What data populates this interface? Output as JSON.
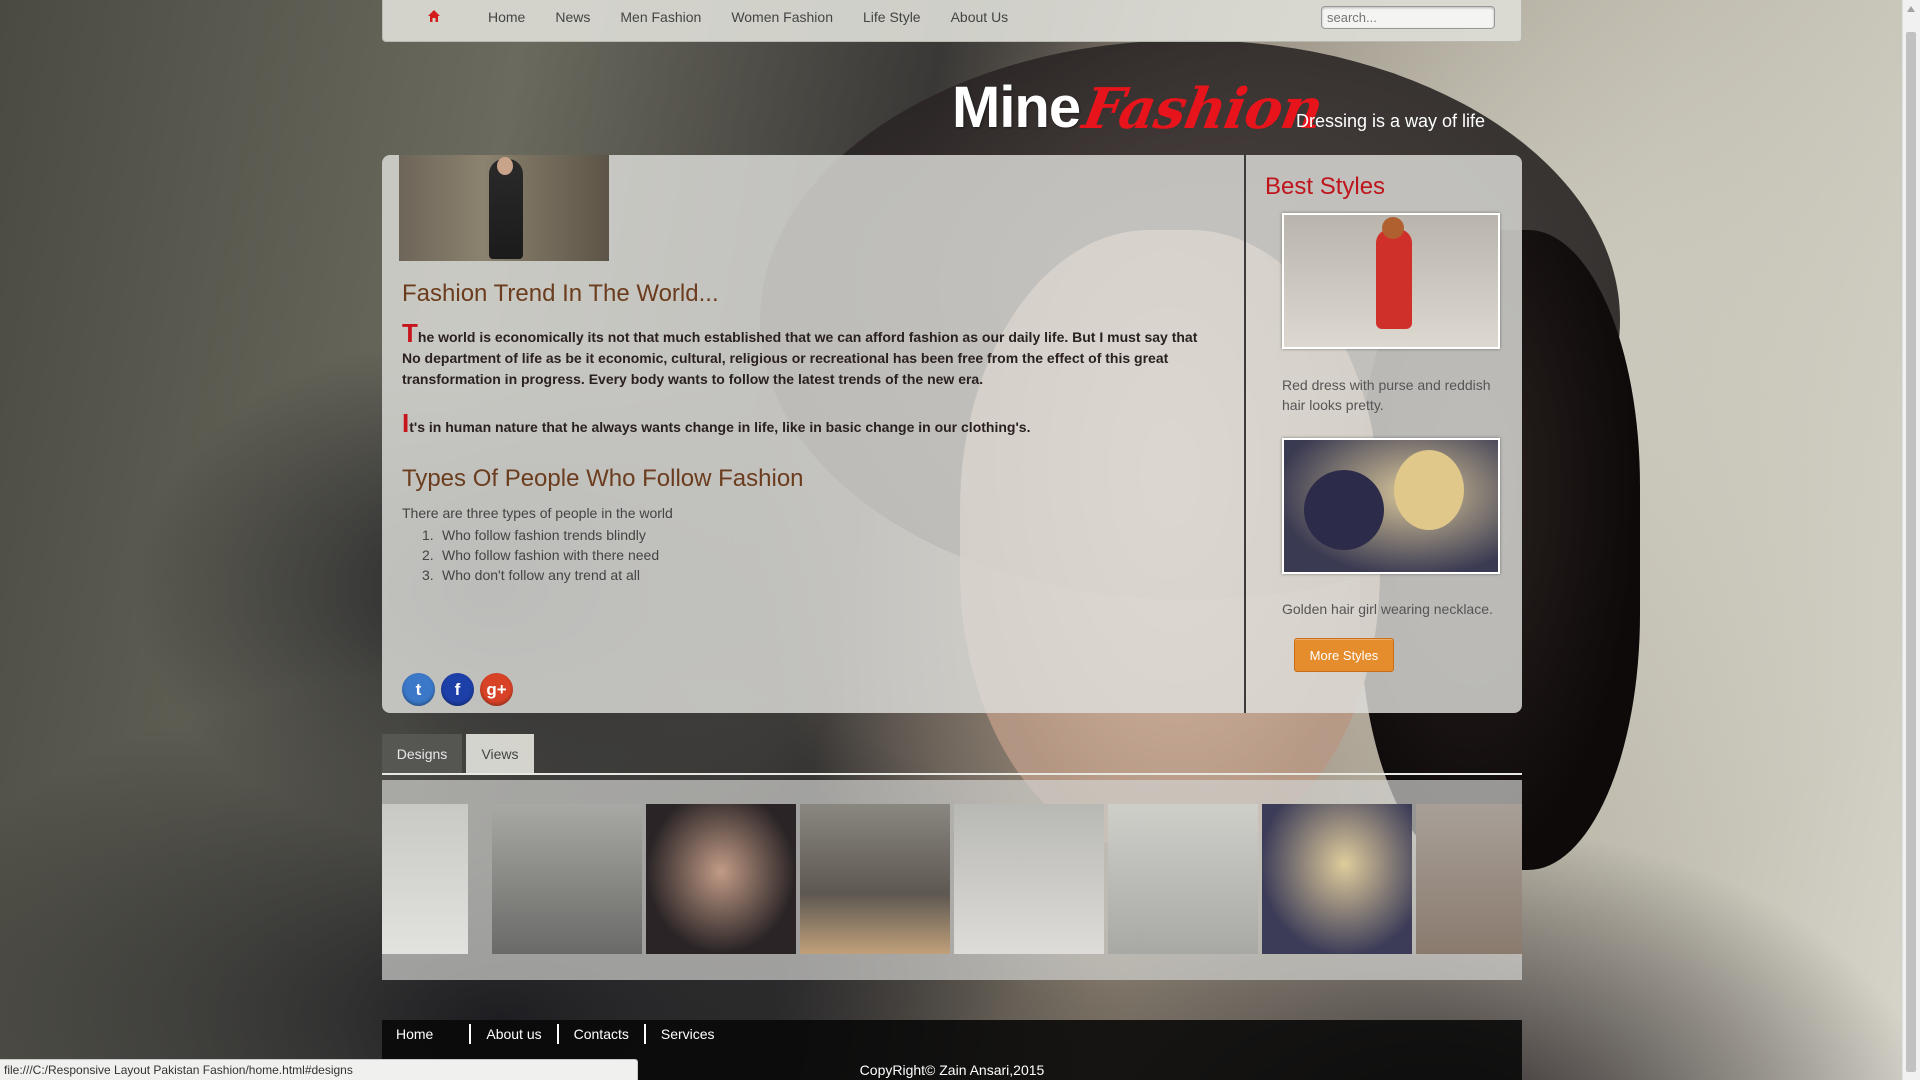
{
  "nav": {
    "home_icon": "home-icon",
    "links": [
      "Home",
      "News",
      "Men Fashion",
      "Women Fashion",
      "Life Style",
      "About Us"
    ],
    "search_placeholder": "search..."
  },
  "brand": {
    "mine": "Mine",
    "fashion": "Fashion",
    "tagline": "Dressing is a way of life"
  },
  "main": {
    "heading": "Fashion Trend In The World...",
    "para1_dropcap": "T",
    "para1_text": "he world is economically its not that much established that we can afford fashion as our daily life. But I must say that No department of life as be it economic, cultural, religious or recreational has been free from the effect of this great transformation in progress. Every body wants to follow the latest trends of the new era.",
    "para2_dropcap": "I",
    "para2_text": "t's in human nature that he always wants change in life, like in basic change in our clothing's.",
    "types_heading": "Types Of People Who Follow Fashion",
    "types_intro": "There are three types of people in the world",
    "types_list": [
      "Who follow fashion trends blindly",
      "Who follow fashion with there need",
      "Who don't follow any trend at all"
    ],
    "social": [
      "twitter-icon",
      "facebook-icon",
      "google-plus-icon"
    ]
  },
  "sidebar": {
    "title": "Best Styles",
    "caption1": "Red dress with purse and reddish hair looks pretty.",
    "caption2": "Golden hair girl wearing necklace.",
    "more_button": "More Styles"
  },
  "tabs": [
    "Designs",
    "Views"
  ],
  "footer": {
    "links": [
      "Home",
      "About us",
      "Contacts",
      "Services"
    ],
    "copyright": "CopyRight© Zain Ansari,2015"
  },
  "status_url": "file:///C:/Responsive Layout Pakistan Fashion/home.html#designs",
  "colors": {
    "brand_red": "#e8141c",
    "heading_brown": "#6b3d1e",
    "button_orange": "#e58c2c"
  }
}
